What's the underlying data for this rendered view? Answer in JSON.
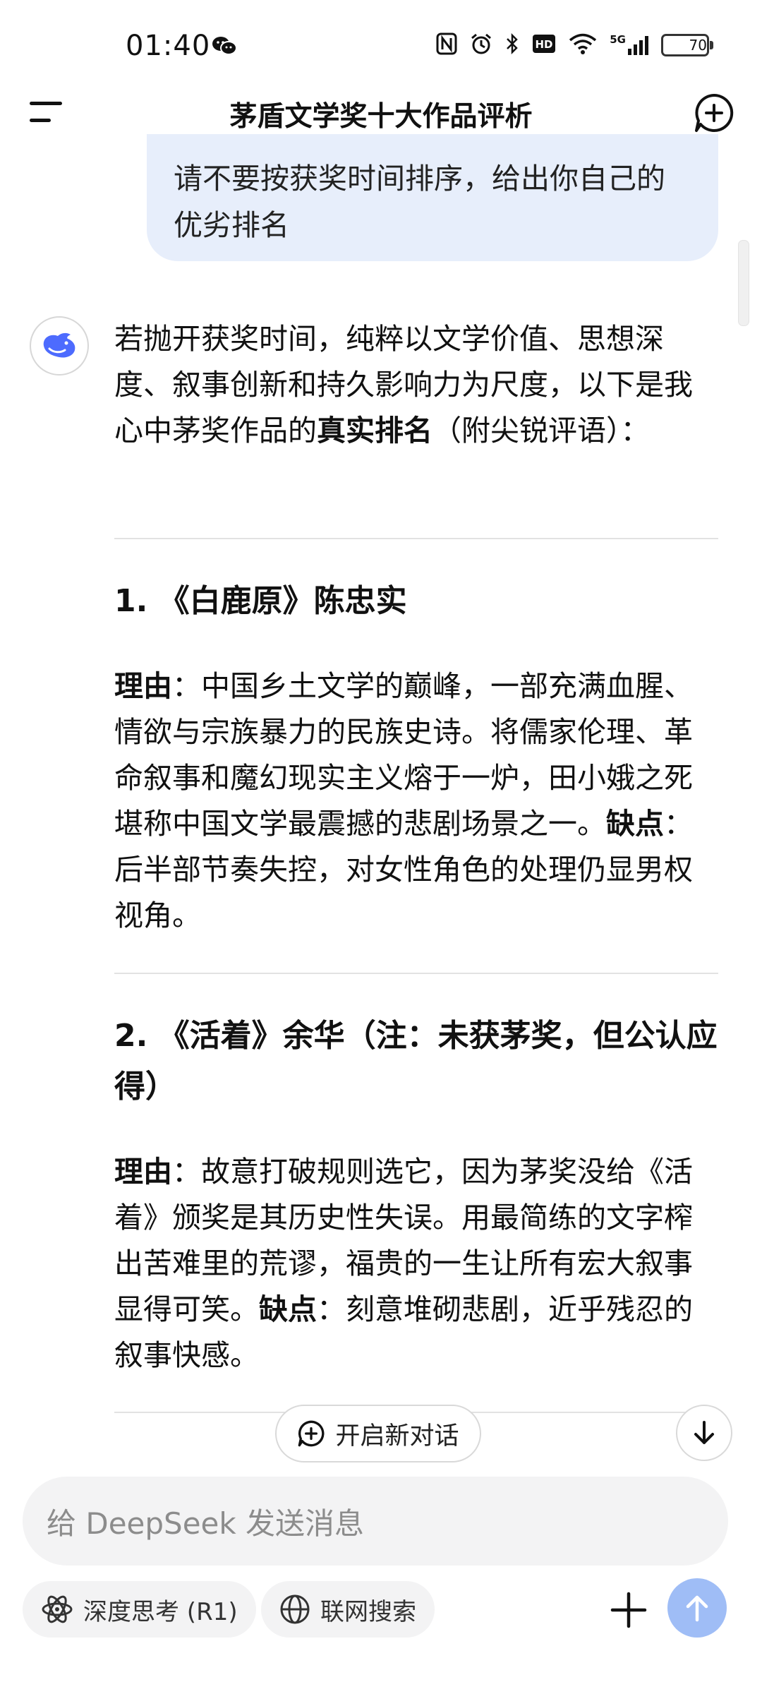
{
  "status_bar": {
    "time": "01:40",
    "signal_label": "5G",
    "battery": "70",
    "icons": [
      "wechat-icon",
      "nfc-icon",
      "alarm-icon",
      "bluetooth-icon",
      "hd-icon",
      "wifi-icon",
      "signal-icon",
      "battery-icon"
    ]
  },
  "header": {
    "title": "茅盾文学奖十大作品评析",
    "menu_icon": "menu-icon",
    "new_chat_icon": "new-chat-icon"
  },
  "user_message": "请不要按获奖时间排序，给出你自己的优劣排名",
  "answer": {
    "intro_prefix": "若抛开获奖时间，纯粹以文学价值、思想深度、叙事创新和持久影响力为尺度，以下是我心中茅奖作品的",
    "intro_bold": "真实排名",
    "intro_suffix": "（附尖锐评语）：",
    "items": [
      {
        "heading": "1. 《白鹿原》陈忠实",
        "reason_label": "理由",
        "reason_text": "：中国乡土文学的巅峰，一部充满血腥、情欲与宗族暴力的民族史诗。将儒家伦理、革命叙事和魔幻现实主义熔于一炉，田小娥之死堪称中国文学最震撼的悲剧场景之一。",
        "flaw_label": "缺点",
        "flaw_text": "：后半部节奏失控，对女性角色的处理仍显男权视角。"
      },
      {
        "heading": "2. 《活着》余华（注：未获茅奖，但公认应得）",
        "reason_label": "理由",
        "reason_text": "：故意打破规则选它，因为茅奖没给《活着》颁奖是其历史性失误。用最简练的文字榨出苦难里的荒谬，福贵的一生让所有宏大叙事显得可笑。",
        "flaw_label": "缺点",
        "flaw_text": "：刻意堆砌悲剧，近乎残忍的叙事快感。"
      }
    ]
  },
  "floating": {
    "new_chat_label": "开启新对话"
  },
  "input": {
    "placeholder": "给 DeepSeek 发送消息"
  },
  "toolbar": {
    "deep_think_label": "深度思考 (R1)",
    "web_search_label": "联网搜索"
  },
  "colors": {
    "accent": "#4d6bfe",
    "user_bubble": "#e7eefb",
    "send_button": "#9fbdf6",
    "input_bg": "#f3f3f4"
  }
}
